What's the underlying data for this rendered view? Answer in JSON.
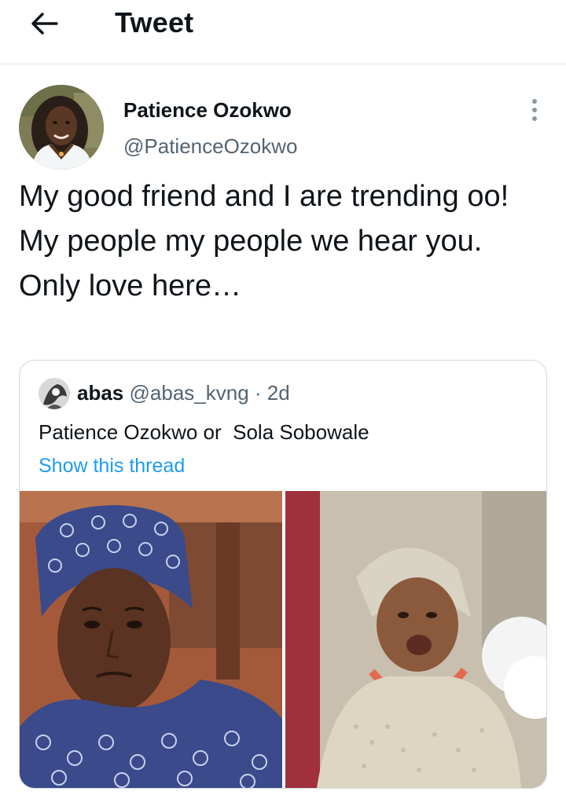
{
  "header": {
    "title": "Tweet",
    "back_icon": "arrow-left-icon"
  },
  "tweet": {
    "display_name": "Patience Ozokwo",
    "handle": "@PatienceOzokwo",
    "text": "My good friend and I are trending oo! My people my people we hear you.\nOnly love here…",
    "more_icon": "more-vertical-icon"
  },
  "quote": {
    "name": "abas",
    "handle": "@abas_kvng",
    "separator": "·",
    "time": "2d",
    "text": "Patience Ozokwo or  Sola Sobowale",
    "show_thread": "Show this thread"
  },
  "colors": {
    "text": "#0f1419",
    "secondary": "#536471",
    "link": "#1d9bf0",
    "border": "#cfd9de"
  }
}
